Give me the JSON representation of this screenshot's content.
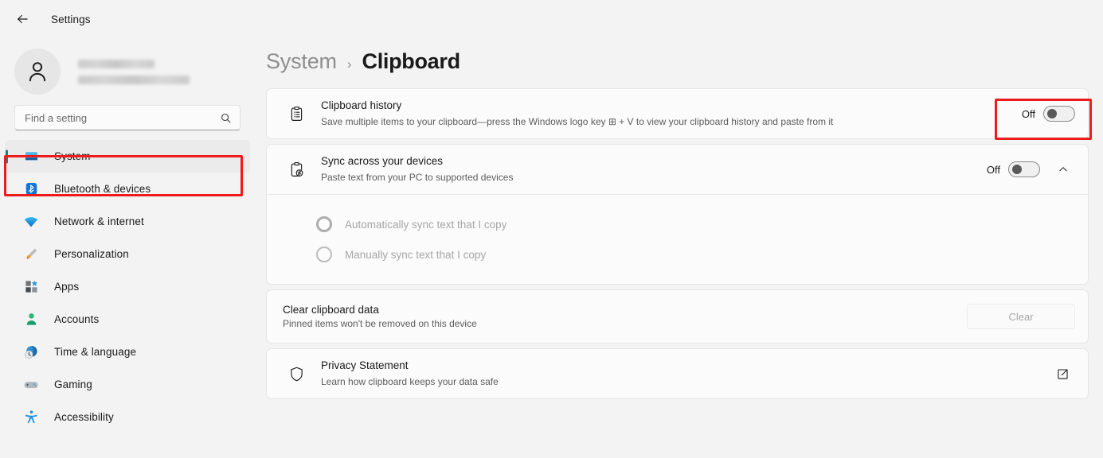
{
  "titlebar": {
    "back_icon": "arrow-left-icon",
    "title": "Settings"
  },
  "sidebar": {
    "profile": {
      "avatar_icon": "person-avatar-icon",
      "name_redacted": "",
      "email_redacted": ""
    },
    "search": {
      "placeholder": "Find a setting",
      "value": "",
      "icon": "search-icon"
    },
    "items": [
      {
        "label": "System",
        "icon": "display-monitor-icon",
        "selected": true
      },
      {
        "label": "Bluetooth & devices",
        "icon": "bluetooth-icon",
        "selected": false
      },
      {
        "label": "Network & internet",
        "icon": "wifi-icon",
        "selected": false
      },
      {
        "label": "Personalization",
        "icon": "paintbrush-icon",
        "selected": false
      },
      {
        "label": "Apps",
        "icon": "apps-grid-icon",
        "selected": false
      },
      {
        "label": "Accounts",
        "icon": "person-icon",
        "selected": false
      },
      {
        "label": "Time & language",
        "icon": "clock-globe-icon",
        "selected": false
      },
      {
        "label": "Gaming",
        "icon": "gamepad-icon",
        "selected": false
      },
      {
        "label": "Accessibility",
        "icon": "accessibility-icon",
        "selected": false
      }
    ]
  },
  "breadcrumb": {
    "parent": "System",
    "separator": "›",
    "current": "Clipboard"
  },
  "main": {
    "clipboard_history": {
      "icon": "clipboard-list-icon",
      "title": "Clipboard history",
      "description": "Save multiple items to your clipboard—press the Windows logo key ⊞ + V to view your clipboard history and paste from it",
      "toggle_state": "Off"
    },
    "sync_across_devices": {
      "icon": "clipboard-sync-icon",
      "title": "Sync across your devices",
      "description": "Paste text from your PC to supported devices",
      "toggle_state": "Off",
      "expand_icon": "chevron-up-icon",
      "options": [
        {
          "label": "Automatically sync text that I copy",
          "selected": false,
          "disabled": true
        },
        {
          "label": "Manually sync text that I copy",
          "selected": false,
          "disabled": true
        }
      ]
    },
    "clear_clipboard": {
      "title": "Clear clipboard data",
      "description": "Pinned items won't be removed on this device",
      "button_label": "Clear",
      "button_disabled": true
    },
    "privacy_statement": {
      "icon": "shield-icon",
      "title": "Privacy Statement",
      "description": "Learn how clipboard keeps your data safe",
      "link_icon": "external-link-icon"
    }
  },
  "annotations": {
    "accent_color": "#ee1b1b",
    "boxes": [
      {
        "name": "sidebar-system-highlight"
      },
      {
        "name": "clipboard-history-toggle-highlight"
      }
    ]
  }
}
